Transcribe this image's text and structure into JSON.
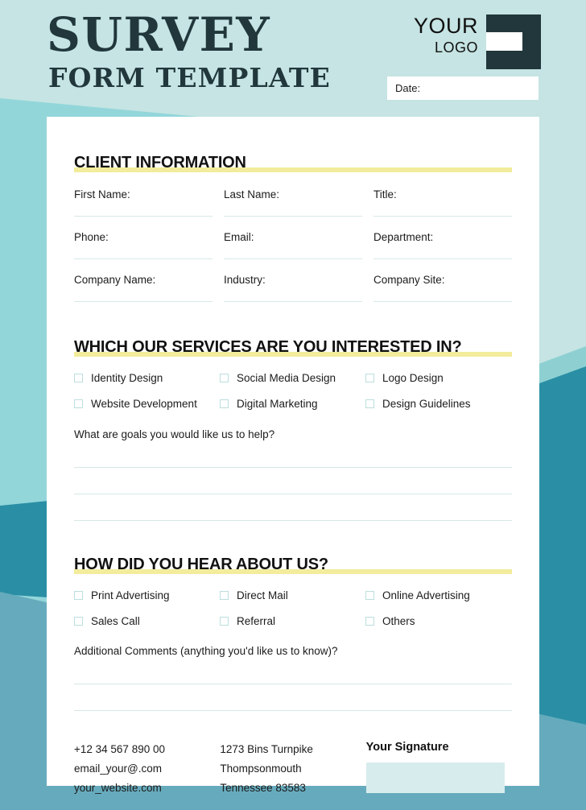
{
  "header": {
    "title_main": "SURVEY",
    "title_sub": "FORM TEMPLATE",
    "logo_line1": "YOUR",
    "logo_line2": "LOGO",
    "date_label": "Date:"
  },
  "sections": {
    "client_information": {
      "heading": "CLIENT INFORMATION",
      "fields": [
        {
          "label": "First Name:"
        },
        {
          "label": "Last Name:"
        },
        {
          "label": "Title:"
        },
        {
          "label": "Phone:"
        },
        {
          "label": "Email:"
        },
        {
          "label": "Department:"
        },
        {
          "label": "Company Name:"
        },
        {
          "label": "Industry:"
        },
        {
          "label": "Company Site:"
        }
      ]
    },
    "services": {
      "heading": "WHICH OUR SERVICES ARE YOU INTERESTED IN?",
      "options": [
        {
          "label": "Identity Design"
        },
        {
          "label": "Social Media Design"
        },
        {
          "label": "Logo Design"
        },
        {
          "label": "Website Development"
        },
        {
          "label": "Digital Marketing"
        },
        {
          "label": "Design Guidelines"
        }
      ],
      "question": "What are goals you would like us to help?",
      "answer_lines": 3
    },
    "hear_about_us": {
      "heading": "HOW DID YOU HEAR ABOUT US?",
      "options": [
        {
          "label": "Print Advertising"
        },
        {
          "label": "Direct Mail"
        },
        {
          "label": "Online Advertising"
        },
        {
          "label": "Sales Call"
        },
        {
          "label": "Referral"
        },
        {
          "label": "Others"
        }
      ],
      "question": "Additional Comments (anything you'd like us to know)?",
      "answer_lines": 2
    }
  },
  "footer": {
    "contact": [
      "+12 34 567 890 00",
      "email_your@.com",
      "your_website.com"
    ],
    "address": [
      "1273 Bins Turnpike",
      "Thompsonmouth",
      "Tennessee 83583"
    ],
    "signature_title": "Your Signature"
  },
  "colors": {
    "background_mint": "#c5e4e3",
    "teal_light": "#93d6da",
    "teal_mid": "#8ed0d2",
    "teal_dark": "#2a8fa5",
    "blue_gray": "#66abbd",
    "ink_dark": "#21373b",
    "accent_yellow": "#f2ec9c",
    "rule_line": "#d7e7e7",
    "checkbox_border": "#bcdedd",
    "signature_fill": "#d7eced",
    "card_white": "#ffffff"
  }
}
